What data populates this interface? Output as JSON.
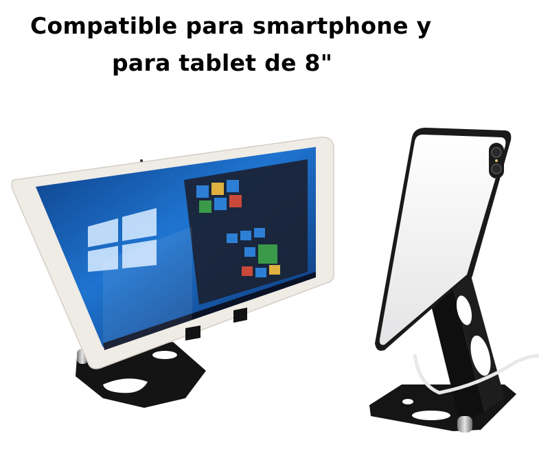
{
  "headline": {
    "line1": "Compatible para smartphone y",
    "line2": "para tablet de 8\""
  },
  "colors": {
    "background": "#ffffff",
    "text": "#000000",
    "stand": "#111111",
    "tablet_frame": "#ece8e2",
    "screen_blue": "#1e6ec8"
  },
  "product_images": [
    {
      "name": "tablet-on-stand",
      "description_icon": "tablet-icon"
    },
    {
      "name": "smartphone-on-stand",
      "description_icon": "phone-icon"
    }
  ]
}
